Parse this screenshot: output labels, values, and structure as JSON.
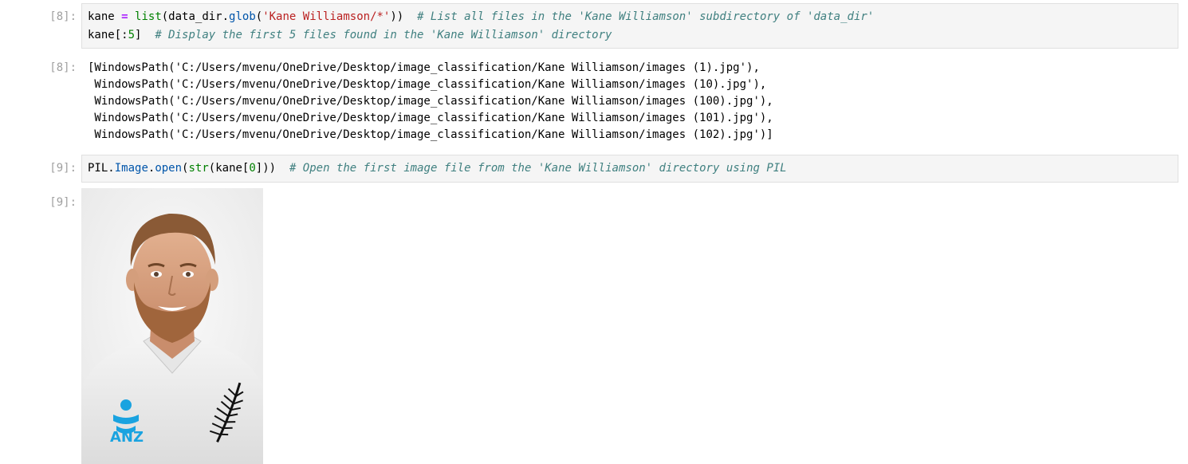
{
  "cells": [
    {
      "in_prompt": "[8]:",
      "out_prompt": "[8]:",
      "code_lines": [
        [
          {
            "t": "kane ",
            "c": "plain"
          },
          {
            "t": "=",
            "c": "op"
          },
          {
            "t": " ",
            "c": "plain"
          },
          {
            "t": "list",
            "c": "kw"
          },
          {
            "t": "(data_dir",
            "c": "plain"
          },
          {
            "t": ".",
            "c": "plain"
          },
          {
            "t": "glob",
            "c": "attr"
          },
          {
            "t": "(",
            "c": "plain"
          },
          {
            "t": "'Kane Williamson/*'",
            "c": "str"
          },
          {
            "t": "))  ",
            "c": "plain"
          },
          {
            "t": "# List all files in the 'Kane Williamson' subdirectory of 'data_dir'",
            "c": "cm"
          }
        ],
        [
          {
            "t": "kane",
            "c": "plain"
          },
          {
            "t": "[:",
            "c": "plain"
          },
          {
            "t": "5",
            "c": "num"
          },
          {
            "t": "]  ",
            "c": "plain"
          },
          {
            "t": "# Display the first 5 files found in the 'Kane Williamson' directory",
            "c": "cm"
          }
        ]
      ],
      "output_lines": [
        "[WindowsPath('C:/Users/mvenu/OneDrive/Desktop/image_classification/Kane Williamson/images (1).jpg'),",
        " WindowsPath('C:/Users/mvenu/OneDrive/Desktop/image_classification/Kane Williamson/images (10).jpg'),",
        " WindowsPath('C:/Users/mvenu/OneDrive/Desktop/image_classification/Kane Williamson/images (100).jpg'),",
        " WindowsPath('C:/Users/mvenu/OneDrive/Desktop/image_classification/Kane Williamson/images (101).jpg'),",
        " WindowsPath('C:/Users/mvenu/OneDrive/Desktop/image_classification/Kane Williamson/images (102).jpg')]"
      ]
    },
    {
      "in_prompt": "[9]:",
      "out_prompt": "[9]:",
      "code_lines": [
        [
          {
            "t": "PIL",
            "c": "plain"
          },
          {
            "t": ".",
            "c": "plain"
          },
          {
            "t": "Image",
            "c": "attr"
          },
          {
            "t": ".",
            "c": "plain"
          },
          {
            "t": "open",
            "c": "attr"
          },
          {
            "t": "(",
            "c": "plain"
          },
          {
            "t": "str",
            "c": "kw"
          },
          {
            "t": "(kane[",
            "c": "plain"
          },
          {
            "t": "0",
            "c": "num"
          },
          {
            "t": "]))  ",
            "c": "plain"
          },
          {
            "t": "# Open the first image file from the 'Kane Williamson' directory using PIL",
            "c": "cm"
          }
        ]
      ],
      "output_image": {
        "icon": "person-photo-icon",
        "logo_text": "ANZ"
      }
    }
  ],
  "colors": {
    "comment": "#408080",
    "string": "#ba2121",
    "builtin": "#008000",
    "operator": "#aa22ff",
    "prompt": "#a0a0a0",
    "input_bg": "#f5f5f5"
  }
}
